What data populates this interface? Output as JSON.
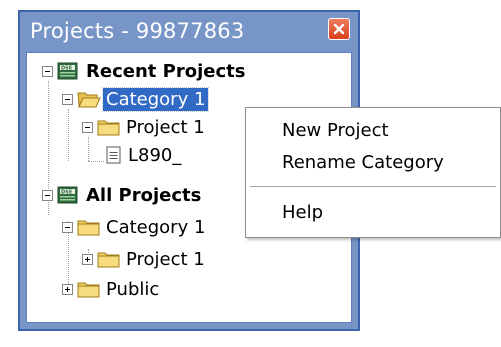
{
  "panel": {
    "title": "Projects - 99877863",
    "close_icon": "close-x-icon"
  },
  "tree": {
    "recent_projects": {
      "label": "Recent Projects",
      "expanded": true,
      "icon": "dse-database-icon",
      "category": {
        "label": "Category 1",
        "expanded": true,
        "selected": true,
        "icon": "open-folder-icon",
        "project": {
          "label": "Project 1",
          "expanded": true,
          "icon": "folder-icon",
          "file": {
            "label": "L890_",
            "icon": "document-icon"
          }
        }
      }
    },
    "all_projects": {
      "label": "All Projects",
      "expanded": true,
      "icon": "dse-database-icon",
      "category": {
        "label": "Category 1",
        "expanded": true,
        "icon": "folder-icon",
        "project": {
          "label": "Project 1",
          "expanded": false,
          "icon": "folder-icon"
        }
      },
      "public": {
        "label": "Public",
        "expanded": false,
        "icon": "folder-icon"
      }
    }
  },
  "context_menu": {
    "items": [
      {
        "label": "New Project"
      },
      {
        "label": "Rename Category"
      },
      {
        "label": "Help"
      }
    ]
  },
  "colors": {
    "title_bar": "#7795c7",
    "border": "#3e64ad",
    "selection": "#316ac5",
    "close_button": "#d8401e",
    "folder": "#f3d46b"
  }
}
